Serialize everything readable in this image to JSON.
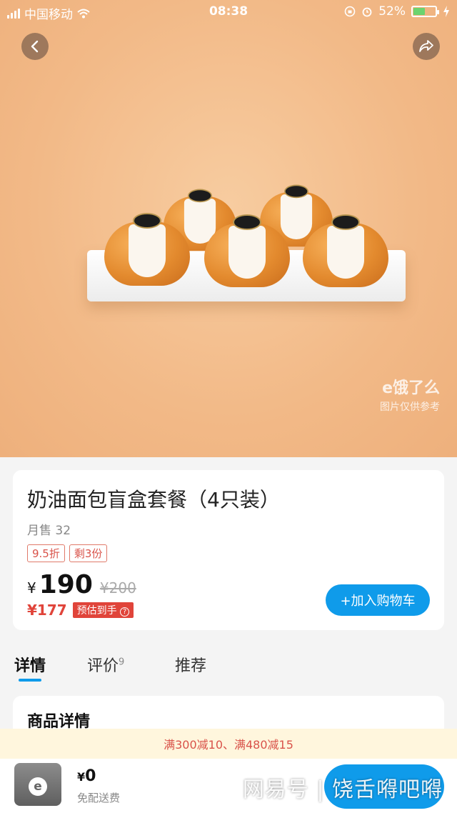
{
  "status": {
    "carrier": "中国移动",
    "time": "08:38",
    "battery": "52%"
  },
  "image": {
    "watermark_brand": "e饿了么",
    "watermark_note": "图片仅供参考"
  },
  "product": {
    "title": "奶油面包盲盒套餐（4只装）",
    "sales": "月售 32",
    "tags": [
      "9.5折",
      "剩3份"
    ],
    "currency": "¥",
    "price": "190",
    "original_price": "¥200",
    "estimated_price": "¥177",
    "estimated_label": "预估到手",
    "add_to_cart": "+加入购物车"
  },
  "tabs": [
    {
      "label": "详情",
      "count": ""
    },
    {
      "label": "评价",
      "count": "9"
    },
    {
      "label": "推荐",
      "count": ""
    }
  ],
  "detail": {
    "heading": "商品详情"
  },
  "promo": {
    "text": "满300减10、满480减15"
  },
  "cart": {
    "currency": "¥",
    "total": "0",
    "delivery": "免配送费"
  },
  "footer_watermark": "网易号 | 饶舌嘚吧嘚"
}
